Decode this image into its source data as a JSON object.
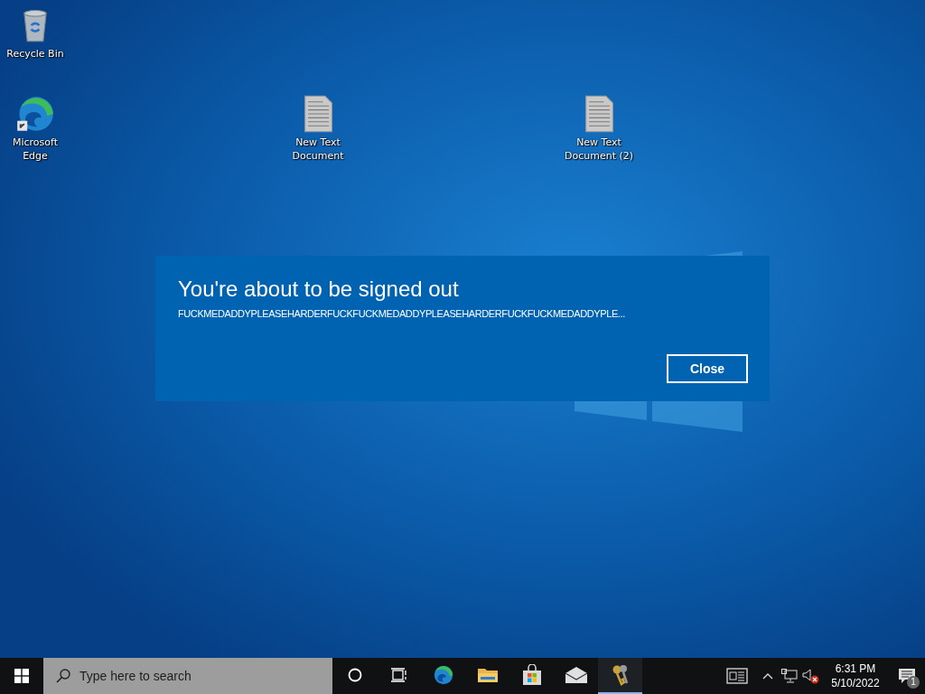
{
  "desktop": {
    "icons": [
      {
        "kind": "recycle",
        "label": "Recycle Bin"
      },
      {
        "kind": "edge",
        "label": "Microsoft Edge"
      },
      {
        "kind": "text",
        "label": "New Text Document"
      },
      {
        "kind": "text",
        "label": "New Text Document (2)"
      }
    ]
  },
  "dialog": {
    "title": "You're about to be signed out",
    "message": "FUCKMEDADDYPLEASEHARDERFUCKFUCKMEDADDYPLEASEHARDERFUCKFUCKMEDADDYPLE...",
    "button": "Close"
  },
  "taskbar": {
    "search": {
      "placeholder": "Type here to search"
    },
    "apps": [
      {
        "kind": "cortana",
        "active": false
      },
      {
        "kind": "taskview",
        "active": false
      },
      {
        "kind": "edge",
        "active": false
      },
      {
        "kind": "folder",
        "active": false
      },
      {
        "kind": "store",
        "active": false
      },
      {
        "kind": "mail",
        "active": false
      },
      {
        "kind": "keys",
        "active": true
      }
    ],
    "time": "6:31 PM",
    "date": "5/10/2022",
    "notifications": "1"
  }
}
